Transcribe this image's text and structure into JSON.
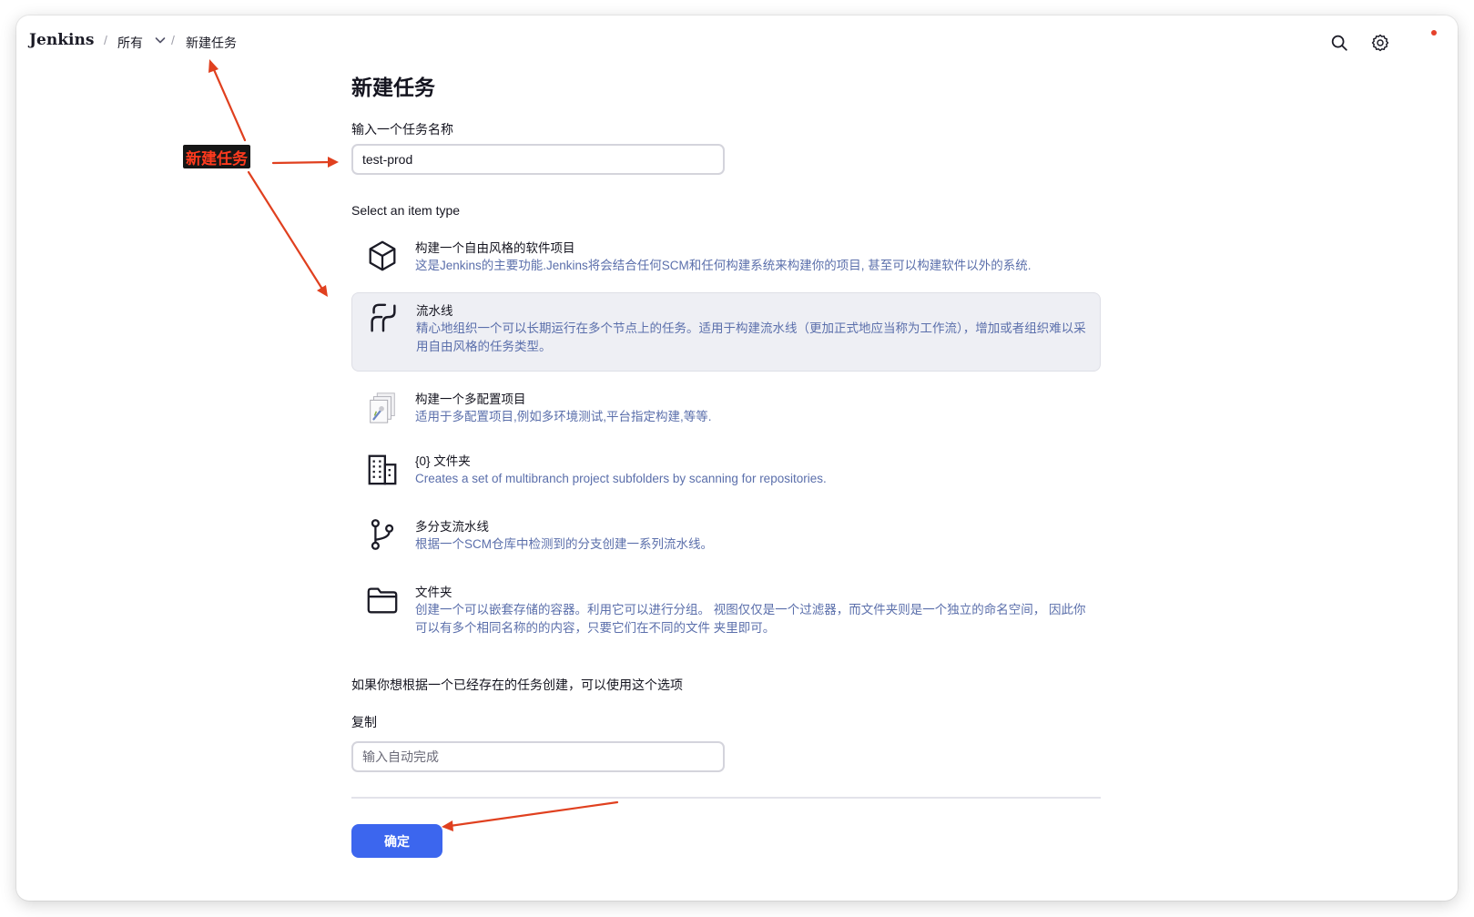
{
  "header": {
    "logo": "Jenkins",
    "breadcrumbs": [
      "所有",
      "新建任务"
    ],
    "separator": "/",
    "icons": [
      "search-icon",
      "gear-icon"
    ],
    "notification_dot_color": "#e5412b"
  },
  "page": {
    "title": "新建任务",
    "name_label": "输入一个任务名称",
    "name_value": "test-prod",
    "type_label": "Select an item type",
    "item_types": [
      {
        "name": "构建一个自由风格的软件项目",
        "desc": "这是Jenkins的主要功能.Jenkins将会结合任何SCM和任何构建系统来构建你的项目, 甚至可以构建软件以外的系统.",
        "icon": "package-icon",
        "selected": false
      },
      {
        "name": "流水线",
        "desc": "精心地组织一个可以长期运行在多个节点上的任务。适用于构建流水线（更加正式地应当称为工作流），增加或者组织难以采用自由风格的任务类型。",
        "icon": "pipeline-icon",
        "selected": true
      },
      {
        "name": "构建一个多配置项目",
        "desc": "适用于多配置项目,例如多环境测试,平台指定构建,等等.",
        "icon": "multi-config-icon",
        "selected": false
      },
      {
        "name": "{0} 文件夹",
        "desc": "Creates a set of multibranch project subfolders by scanning for repositories.",
        "icon": "organization-folder-icon",
        "selected": false
      },
      {
        "name": "多分支流水线",
        "desc": "根据一个SCM仓库中检测到的分支创建一系列流水线。",
        "icon": "branch-icon",
        "selected": false
      },
      {
        "name": "文件夹",
        "desc": "创建一个可以嵌套存储的容器。利用它可以进行分组。 视图仅仅是一个过滤器，而文件夹则是一个独立的命名空间， 因此你可以有多个相同名称的的内容，只要它们在不同的文件 夹里即可。",
        "icon": "folder-icon",
        "selected": false
      }
    ],
    "copy_hint": "如果你想根据一个已经存在的任务创建，可以使用这个选项",
    "copy_label": "复制",
    "copy_placeholder": "输入自动完成",
    "ok_label": "确定"
  },
  "annotation": {
    "label": "新建任务",
    "color": "#e0401f"
  },
  "colors": {
    "accent": "#3c66ee",
    "description_text": "#5b6fab",
    "selected_bg": "#eeeff4"
  }
}
